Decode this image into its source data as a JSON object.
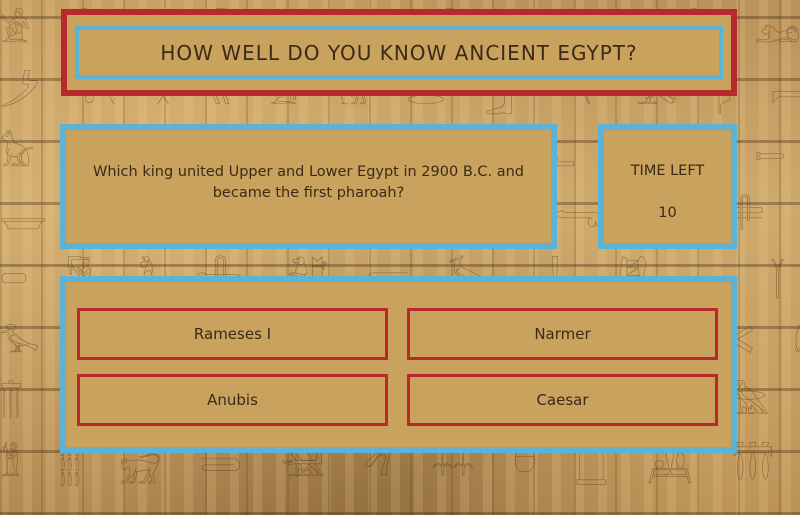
{
  "title": "HOW WELL DO YOU KNOW ANCIENT EGYPT?",
  "question": "Which king united Upper and Lower Egypt in 2900 B.C. and became the first pharoah?",
  "timer": {
    "label": "TIME LEFT",
    "value": "10"
  },
  "answers": [
    {
      "label": "Rameses I"
    },
    {
      "label": "Narmer"
    },
    {
      "label": "Anubis"
    },
    {
      "label": "Caesar"
    }
  ],
  "colors": {
    "panel": "#c9a25e",
    "title_border": "#b8282c",
    "accent_border": "#5db3d6",
    "answer_border": "#b8282c",
    "text": "#3a2a18"
  }
}
